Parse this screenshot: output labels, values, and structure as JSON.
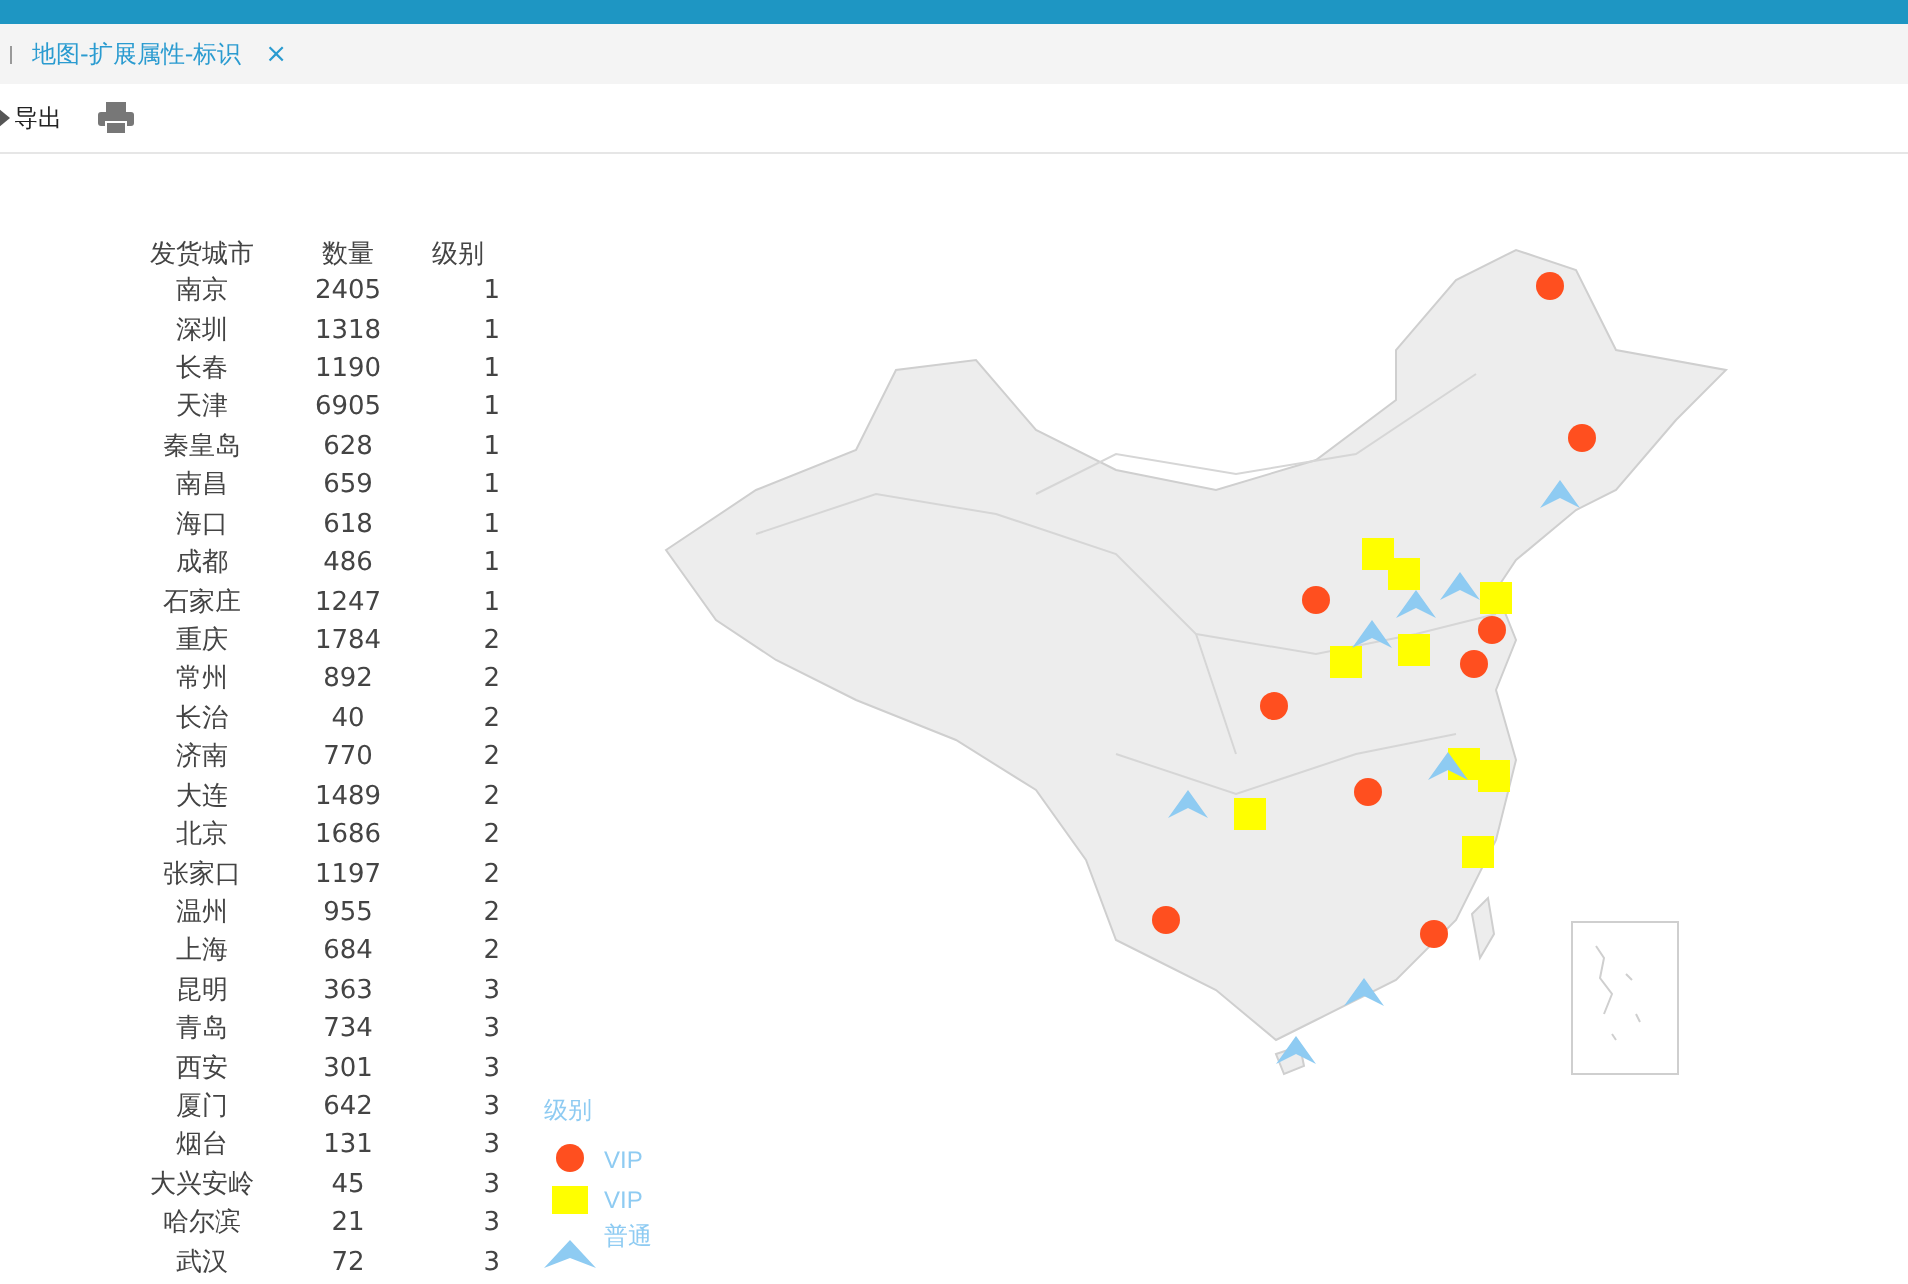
{
  "tab": {
    "label": "地图-扩展属性-标识",
    "close": "×"
  },
  "toolbar": {
    "export": "导出"
  },
  "table": {
    "columns": [
      "发货城市",
      "数量",
      "级别"
    ],
    "rows": [
      {
        "city": "南京",
        "qty": "2405",
        "level": "1"
      },
      {
        "city": "深圳",
        "qty": "1318",
        "level": "1"
      },
      {
        "city": "长春",
        "qty": "1190",
        "level": "1"
      },
      {
        "city": "天津",
        "qty": "6905",
        "level": "1"
      },
      {
        "city": "秦皇岛",
        "qty": "628",
        "level": "1"
      },
      {
        "city": "南昌",
        "qty": "659",
        "level": "1"
      },
      {
        "city": "海口",
        "qty": "618",
        "level": "1"
      },
      {
        "city": "成都",
        "qty": "486",
        "level": "1"
      },
      {
        "city": "石家庄",
        "qty": "1247",
        "level": "1"
      },
      {
        "city": "重庆",
        "qty": "1784",
        "level": "2"
      },
      {
        "city": "常州",
        "qty": "892",
        "level": "2"
      },
      {
        "city": "长治",
        "qty": "40",
        "level": "2"
      },
      {
        "city": "济南",
        "qty": "770",
        "level": "2"
      },
      {
        "city": "大连",
        "qty": "1489",
        "level": "2"
      },
      {
        "city": "北京",
        "qty": "1686",
        "level": "2"
      },
      {
        "city": "张家口",
        "qty": "1197",
        "level": "2"
      },
      {
        "city": "温州",
        "qty": "955",
        "level": "2"
      },
      {
        "city": "上海",
        "qty": "684",
        "level": "2"
      },
      {
        "city": "昆明",
        "qty": "363",
        "level": "3"
      },
      {
        "city": "青岛",
        "qty": "734",
        "level": "3"
      },
      {
        "city": "西安",
        "qty": "301",
        "level": "3"
      },
      {
        "city": "厦门",
        "qty": "642",
        "level": "3"
      },
      {
        "city": "烟台",
        "qty": "131",
        "level": "3"
      },
      {
        "city": "大兴安岭",
        "qty": "45",
        "level": "3"
      },
      {
        "city": "哈尔滨",
        "qty": "21",
        "level": "3"
      },
      {
        "city": "武汉",
        "qty": "72",
        "level": "3"
      }
    ]
  },
  "legend": {
    "title": "级别",
    "items": [
      {
        "kind": "circle",
        "label": "VIP",
        "color": "#ff4f1f"
      },
      {
        "kind": "square",
        "label": "VIP",
        "color": "#ffff00"
      },
      {
        "kind": "triangle",
        "label": "普通",
        "color": "#8ecbf2"
      }
    ]
  }
}
